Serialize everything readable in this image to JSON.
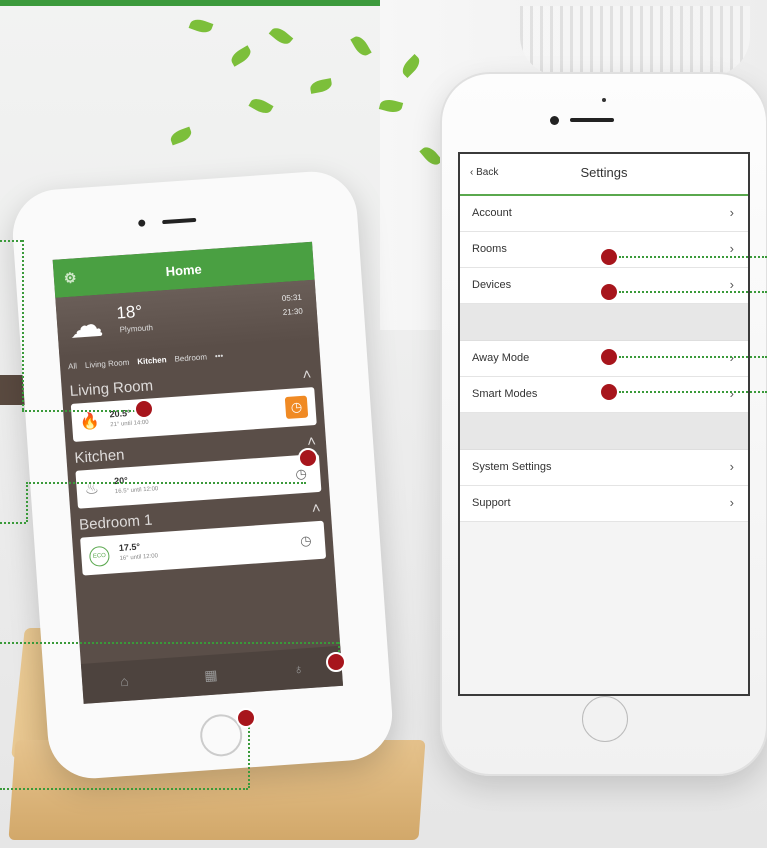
{
  "colors": {
    "accent": "#4aa042",
    "marker": "#a7151c",
    "leader": "#3a9a3a",
    "heating": "#f08a24"
  },
  "left_phone": {
    "header_title": "Home",
    "gear_icon": "gear-icon",
    "weather": {
      "temp": "18°",
      "location": "Plymouth",
      "sun_times": "05:31\n21:30"
    },
    "tabs": [
      "All",
      "Living Room",
      "Kitchen",
      "Bedroom",
      "•••"
    ],
    "rooms": [
      {
        "name": "Living Room",
        "temp": "20.5°",
        "sub": "21° until 14:00",
        "icon": "flame-icon",
        "timer_active": true
      },
      {
        "name": "Kitchen",
        "temp": "20°",
        "sub": "16.5° until 12:00",
        "icon": "flame-outline-icon",
        "timer_active": false
      },
      {
        "name": "Bedroom 1",
        "temp": "17.5°",
        "sub": "16° until 12:00",
        "icon": "eco-icon",
        "eco_label": "ECO",
        "timer_active": false
      }
    ],
    "nav": [
      "home-icon",
      "grid-icon",
      "bulb-icon"
    ]
  },
  "right_phone": {
    "back_label": "Back",
    "title": "Settings",
    "group1": [
      "Account",
      "Rooms",
      "Devices"
    ],
    "group2": [
      "Away Mode",
      "Smart Modes"
    ],
    "group3": [
      "System Settings",
      "Support"
    ],
    "chevron": "›"
  }
}
